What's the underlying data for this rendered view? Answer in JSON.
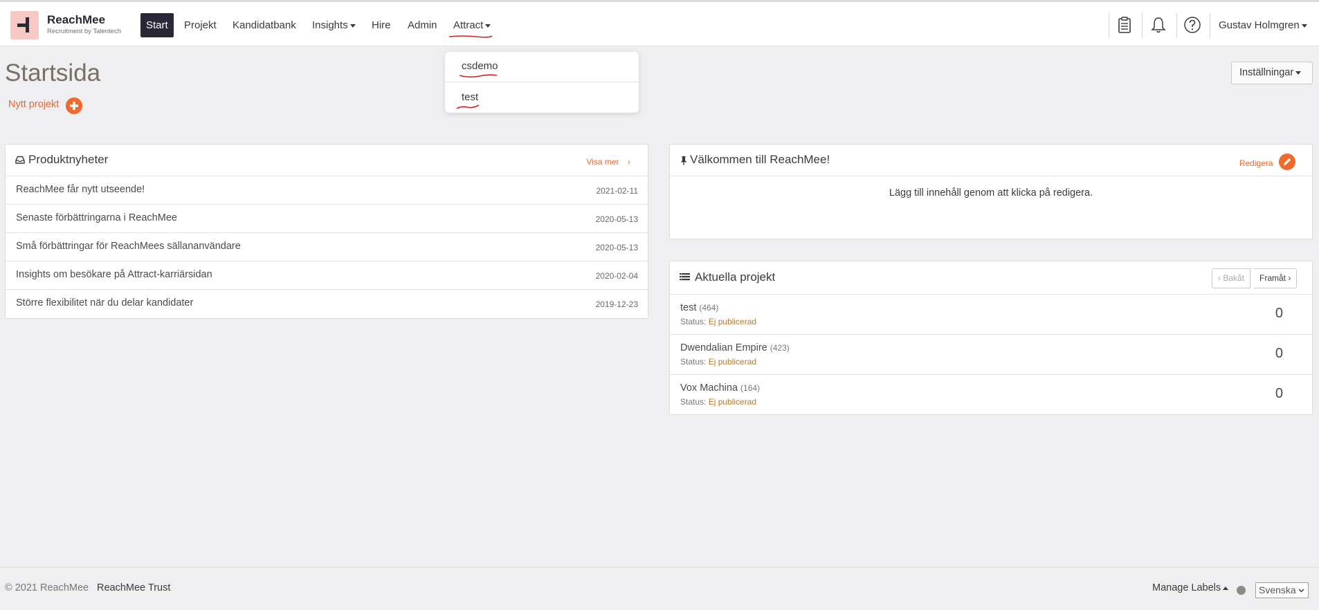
{
  "brand": {
    "name": "ReachMee",
    "tagline": "Recruitment by Talentech"
  },
  "nav": {
    "start": "Start",
    "projekt": "Projekt",
    "kandidatbank": "Kandidatbank",
    "insights": "Insights",
    "hire": "Hire",
    "admin": "Admin",
    "attract": "Attract",
    "user": "Gustav Holmgren"
  },
  "attract_menu": {
    "items": [
      "csdemo",
      "test"
    ]
  },
  "page": {
    "title": "Startsida",
    "new_project": "Nytt projekt",
    "settings_button": "Inställningar"
  },
  "news": {
    "title": "Produktnyheter",
    "show_more": "Visa mer",
    "items": [
      {
        "title": "ReachMee får nytt utseende!",
        "date": "2021-02-11"
      },
      {
        "title": "Senaste förbättringarna i ReachMee",
        "date": "2020-05-13"
      },
      {
        "title": "Små förbättringar för ReachMees sällananvändare",
        "date": "2020-05-13"
      },
      {
        "title": "Insights om besökare på Attract-karriärsidan",
        "date": "2020-02-04"
      },
      {
        "title": "Större flexibilitet när du delar kandidater",
        "date": "2019-12-23"
      }
    ]
  },
  "welcome": {
    "title": "Välkommen till ReachMee!",
    "edit": "Redigera",
    "body": "Lägg till innehåll genom att klicka på redigera."
  },
  "projects": {
    "title": "Aktuella projekt",
    "prev": "Bakåt",
    "next": "Framåt",
    "status_label": "Status:",
    "items": [
      {
        "name": "test",
        "count": "(464)",
        "status": "Ej publicerad",
        "value": "0"
      },
      {
        "name": "Dwendalian Empire",
        "count": "(423)",
        "status": "Ej publicerad",
        "value": "0"
      },
      {
        "name": "Vox Machina",
        "count": "(164)",
        "status": "Ej publicerad",
        "value": "0"
      }
    ]
  },
  "footer": {
    "copyright": "© 2021 ReachMee",
    "trust": "ReachMee Trust",
    "manage_labels": "Manage Labels",
    "language": "Svenska"
  },
  "colors": {
    "accent": "#e9682e",
    "nav_active": "#2a2737",
    "logo_bg": "#f6c9c5",
    "annotation": "#d62020"
  }
}
